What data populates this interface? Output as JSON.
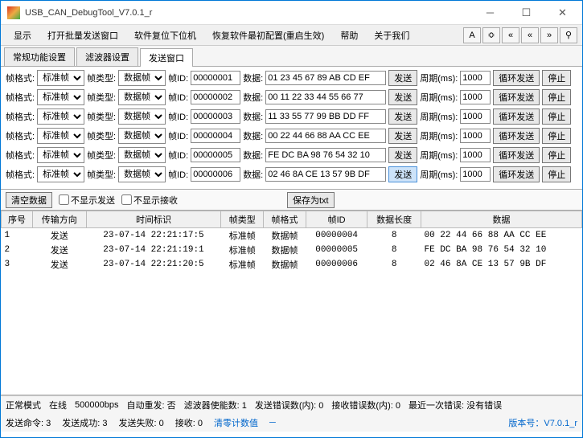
{
  "window": {
    "title": "USB_CAN_DebugTool_V7.0.1_r"
  },
  "menu": {
    "display": "显示",
    "openBatch": "打开批量发送窗口",
    "softReset": "软件复位下位机",
    "restoreInit": "恢复软件最初配置(重启生效)",
    "help": "帮助",
    "about": "关于我们"
  },
  "toolbar_icons": [
    "A",
    "≎",
    "«",
    "«",
    "»",
    "⚲"
  ],
  "tabs": {
    "t1": "常规功能设置",
    "t2": "滤波器设置",
    "t3": "发送窗口"
  },
  "row_labels": {
    "format": "帧格式:",
    "type": "帧类型:",
    "id": "帧ID:",
    "data": "数据:",
    "send": "发送",
    "period": "周期(ms):",
    "loopSend": "循环发送",
    "stop": "停止"
  },
  "select_format": "标准帧",
  "select_type": "数据帧",
  "rows": [
    {
      "id": "00000001",
      "data": "01 23 45 67 89 AB CD EF",
      "period": "1000",
      "hl": false
    },
    {
      "id": "00000002",
      "data": "00 11 22 33 44 55 66 77",
      "period": "1000",
      "hl": false
    },
    {
      "id": "00000003",
      "data": "11 33 55 77 99 BB DD FF",
      "period": "1000",
      "hl": false
    },
    {
      "id": "00000004",
      "data": "00 22 44 66 88 AA CC EE",
      "period": "1000",
      "hl": false
    },
    {
      "id": "00000005",
      "data": "FE DC BA 98 76 54 32 10",
      "period": "1000",
      "hl": false
    },
    {
      "id": "00000006",
      "data": "02 46 8A CE 13 57 9B DF",
      "period": "1000",
      "hl": true
    }
  ],
  "mid": {
    "clear": "清空数据",
    "hideSend": "不显示发送",
    "hideRecv": "不显示接收",
    "saveTxt": "保存为txt"
  },
  "grid": {
    "headers": {
      "seq": "序号",
      "dir": "传输方向",
      "time": "时间标识",
      "type": "帧类型",
      "format": "帧格式",
      "id": "帧ID",
      "len": "数据长度",
      "data": "数据"
    },
    "rows": [
      {
        "seq": "1",
        "dir": "发送",
        "time": "23-07-14 22:21:17:5",
        "type": "标准帧",
        "format": "数据帧",
        "id": "00000004",
        "len": "8",
        "data": "00 22 44 66 88 AA CC EE"
      },
      {
        "seq": "2",
        "dir": "发送",
        "time": "23-07-14 22:21:19:1",
        "type": "标准帧",
        "format": "数据帧",
        "id": "00000005",
        "len": "8",
        "data": "FE DC BA 98 76 54 32 10"
      },
      {
        "seq": "3",
        "dir": "发送",
        "time": "23-07-14 22:21:20:5",
        "type": "标准帧",
        "format": "数据帧",
        "id": "00000006",
        "len": "8",
        "data": "02 46 8A CE 13 57 9B DF"
      }
    ]
  },
  "status1": {
    "mode": "正常模式",
    "online": "在线",
    "baud": "500000bps",
    "autoResend": "自动重发:",
    "autoResendVal": "否",
    "filterEnable": "滤波器使能数:",
    "filterEnableVal": "1",
    "sendErrIn": "发送错误数(内):",
    "sendErrInVal": "0",
    "recvErrIn": "接收错误数(内):",
    "recvErrInVal": "0",
    "lastErr": "最近一次错误:",
    "lastErrVal": "没有错误"
  },
  "status2": {
    "sendCmd": "发送命令:",
    "sendCmdVal": "3",
    "sendOk": "发送成功:",
    "sendOkVal": "3",
    "sendFail": "发送失败:",
    "sendFailVal": "0",
    "recvCnt": "接收:",
    "recvCntVal": "0",
    "clearCount": "清零计数值",
    "versionLabel": "版本号：",
    "versionVal": "V7.0.1_r"
  }
}
